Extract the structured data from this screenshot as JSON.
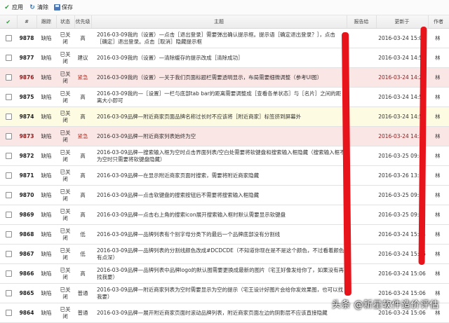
{
  "toolbar": {
    "apply_label": "应用",
    "clear_label": "清除",
    "save_label": "保存"
  },
  "columns": {
    "check": "✔",
    "id": "#",
    "type": "跟踪",
    "status": "状态",
    "priority": "优先级",
    "summary": "主题",
    "reporter": "报告给",
    "updated": "更新于",
    "author": "作者"
  },
  "rows": [
    {
      "id": "9878",
      "type": "缺陷",
      "status": "已关闭",
      "priority": "高",
      "summary": "2016-03-09我的（设置）—点击［退出登录］需要弹出确认提示框。提示语［确定退出登录？］，点击［确定］退出登录。点击［取消］隐藏提示框",
      "updated": "2016-03-24 15:07",
      "author": "林",
      "tone": "white"
    },
    {
      "id": "9877",
      "type": "缺陷",
      "status": "已关闭",
      "priority": "建议",
      "summary": "2016-03-09我的（设置）—清除缓存的提示改成［清除成功］",
      "updated": "2016-03-24 14:56",
      "author": "林",
      "tone": "white"
    },
    {
      "id": "9876",
      "type": "缺陷",
      "status": "已关闭",
      "priority": "紧急",
      "summary": "2016-03-09我的（设置）—关于我们页面标题栏需要透明显示，布局需要细微调整（参考UI图）",
      "updated": "2016-03-24 14:24",
      "author": "林",
      "tone": "red"
    },
    {
      "id": "9875",
      "type": "缺陷",
      "status": "已关闭",
      "priority": "高",
      "summary": "2016-03-09我的—［设置］一栏与底部tab bar的距离需要调整成［查看各单状态］与［名片］之间的距离大小即可",
      "updated": "2016-03-24 14:50",
      "author": "林",
      "tone": "white"
    },
    {
      "id": "9874",
      "type": "缺陷",
      "status": "已关闭",
      "priority": "高",
      "summary": "2016-03-09品牌—附近商家页面品牌名称过长时不应该将［附近商家］标签挤到屏幕外",
      "updated": "2016-03-24 14:53",
      "author": "林",
      "tone": "yellow"
    },
    {
      "id": "9873",
      "type": "缺陷",
      "status": "已关闭",
      "priority": "紧急",
      "summary": "2016-03-09品牌—附近商家列表始终为空",
      "updated": "2016-03-24 14:23",
      "author": "林",
      "tone": "red"
    },
    {
      "id": "9872",
      "type": "缺陷",
      "status": "已关闭",
      "priority": "高",
      "summary": "2016-03-09品牌—搜索输入框为空时点击界面列表/空白处需要将软键盘和搜索输入框隐藏（搜索输入框不为空时只需要将软键盘隐藏）",
      "updated": "2016-03-25 09:44",
      "author": "林",
      "tone": "white"
    },
    {
      "id": "9871",
      "type": "缺陷",
      "status": "已关闭",
      "priority": "高",
      "summary": "2016-03-09品牌—在显示附近商家页面时搜索，需要将附近商家隐藏",
      "updated": "2016-03-26 13:23",
      "author": "林",
      "tone": "white"
    },
    {
      "id": "9870",
      "type": "缺陷",
      "status": "已关闭",
      "priority": "高",
      "summary": "2016-03-09品牌—点击软键盘的搜索按钮后不需要将搜索输入框隐藏",
      "updated": "2016-03-25 09:45",
      "author": "林",
      "tone": "white"
    },
    {
      "id": "9869",
      "type": "缺陷",
      "status": "已关闭",
      "priority": "高",
      "summary": "2016-03-09品牌—点击右上角的搜索icon展开搜索输入框时默认需要显示软键盘",
      "updated": "2016-03-25 09:45",
      "author": "林",
      "tone": "white"
    },
    {
      "id": "9868",
      "type": "缺陷",
      "status": "已关闭",
      "priority": "低",
      "summary": "2016-03-09品牌—品牌列表有个别字母分类下的最后一个品牌底部没有分割线",
      "updated": "2016-03-24 15:04",
      "author": "林",
      "tone": "white"
    },
    {
      "id": "9867",
      "type": "缺陷",
      "status": "已关闭",
      "priority": "低",
      "summary": "2016-03-09品牌—品牌列表的分割线颜色改成#DCDCDE（不知道你现在是不是这个颜色，不过看着颜色有点深）",
      "updated": "2016-03-24 15:06",
      "author": "林",
      "tone": "white"
    },
    {
      "id": "9866",
      "type": "缺陷",
      "status": "已关闭",
      "priority": "高",
      "summary": "2016-03-09品牌—品牌列表中品牌logo的默认图需要更换成最新的图片（宅王好像发给你了，如果没有再找我要）",
      "updated": "2016-03-24 15:06",
      "author": "林",
      "tone": "white"
    },
    {
      "id": "9865",
      "type": "缺陷",
      "status": "已关闭",
      "priority": "普通",
      "summary": "2016-03-09品牌—附近商家列表为空时需要显示为空的提示（宅王设计好图片会给你发效果图，也可以找我要）",
      "updated": "2016-03-24 15:06",
      "author": "林",
      "tone": "white"
    },
    {
      "id": "9864",
      "type": "缺陷",
      "status": "已关闭",
      "priority": "普通",
      "summary": "2016-03-09品牌—展开附近商家页面时滚动品牌列表，附近商家页面左边的阴影层不应该直接隐藏",
      "updated": "2016-03-24 15:06",
      "author": "林",
      "tone": "white"
    }
  ],
  "watermark": "头条 @新星软件造价评估",
  "colors": {
    "row_red": "#fbe6e6",
    "row_yellow": "#fdfbe2",
    "urgent_text": "#c0392b",
    "annotation_red": "#e8141b"
  }
}
